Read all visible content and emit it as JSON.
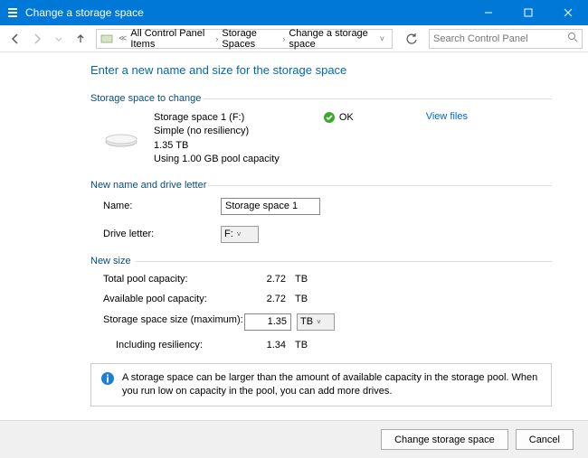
{
  "titlebar": {
    "title": "Change a storage space"
  },
  "breadcrumb": {
    "items": [
      "All Control Panel Items",
      "Storage Spaces",
      "Change a storage space"
    ]
  },
  "search": {
    "placeholder": "Search Control Panel"
  },
  "heading": "Enter a new name and size for the storage space",
  "group1": {
    "title": "Storage space to change",
    "name": "Storage space 1 (F:)",
    "resiliency": "Simple (no resiliency)",
    "size": "1.35 TB",
    "usage": "Using 1.00 GB pool capacity",
    "status": "OK",
    "viewfiles": "View files"
  },
  "group2": {
    "title": "New name and drive letter",
    "name_label": "Name:",
    "name_value": "Storage space 1",
    "drive_label": "Drive letter:",
    "drive_value": "F:"
  },
  "group3": {
    "title": "New size",
    "total_label": "Total pool capacity:",
    "total_val": "2.72",
    "total_unit": "TB",
    "avail_label": "Available pool capacity:",
    "avail_val": "2.72",
    "avail_unit": "TB",
    "max_label": "Storage space size (maximum):",
    "max_val": "1.35",
    "max_unit": "TB",
    "resil_label": "Including resiliency:",
    "resil_val": "1.34",
    "resil_unit": "TB"
  },
  "info": "A storage space can be larger than the amount of available capacity in the storage pool. When you run low on capacity in the pool, you can add more drives.",
  "footer": {
    "change": "Change storage space",
    "cancel": "Cancel"
  }
}
